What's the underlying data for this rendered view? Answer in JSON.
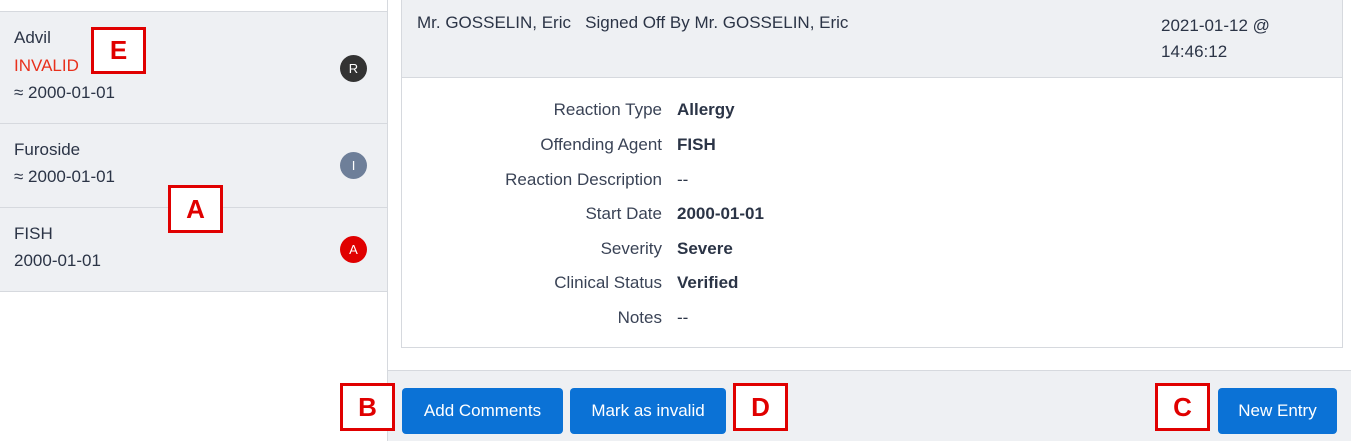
{
  "list": {
    "items": [
      {
        "name": "Advil",
        "status": "INVALID",
        "date": "≈ 2000-01-01",
        "badge": "R",
        "badge_color": "#333333"
      },
      {
        "name": "Furoside",
        "status": "",
        "date": "≈ 2000-01-01",
        "badge": "I",
        "badge_color": "#6e7f99"
      },
      {
        "name": "FISH",
        "status": "",
        "date": "2000-01-01",
        "badge": "A",
        "badge_color": "#e00000"
      }
    ]
  },
  "detail": {
    "header": {
      "text": "Mr. GOSSELIN, Eric   Signed Off By Mr. GOSSELIN, Eric",
      "date_line1": "2021-01-12 @",
      "date_line2": "14:46:12"
    },
    "fields": [
      {
        "label": "Reaction Type",
        "value": "Allergy"
      },
      {
        "label": "Offending Agent",
        "value": "FISH"
      },
      {
        "label": "Reaction Description",
        "value": "--"
      },
      {
        "label": "Start Date",
        "value": "2000-01-01"
      },
      {
        "label": "Severity",
        "value": "Severe"
      },
      {
        "label": "Clinical Status",
        "value": "Verified"
      },
      {
        "label": "Notes",
        "value": "--"
      }
    ]
  },
  "footer": {
    "add_comments": "Add Comments",
    "mark_invalid": "Mark as invalid",
    "new_entry": "New Entry"
  },
  "annotations": {
    "a": "A",
    "b": "B",
    "c": "C",
    "d": "D",
    "e": "E"
  },
  "colors": {
    "accent": "#0b72d6",
    "invalid": "#e8301c",
    "annotation": "#e00000",
    "panel_bg": "#eef0f3"
  }
}
